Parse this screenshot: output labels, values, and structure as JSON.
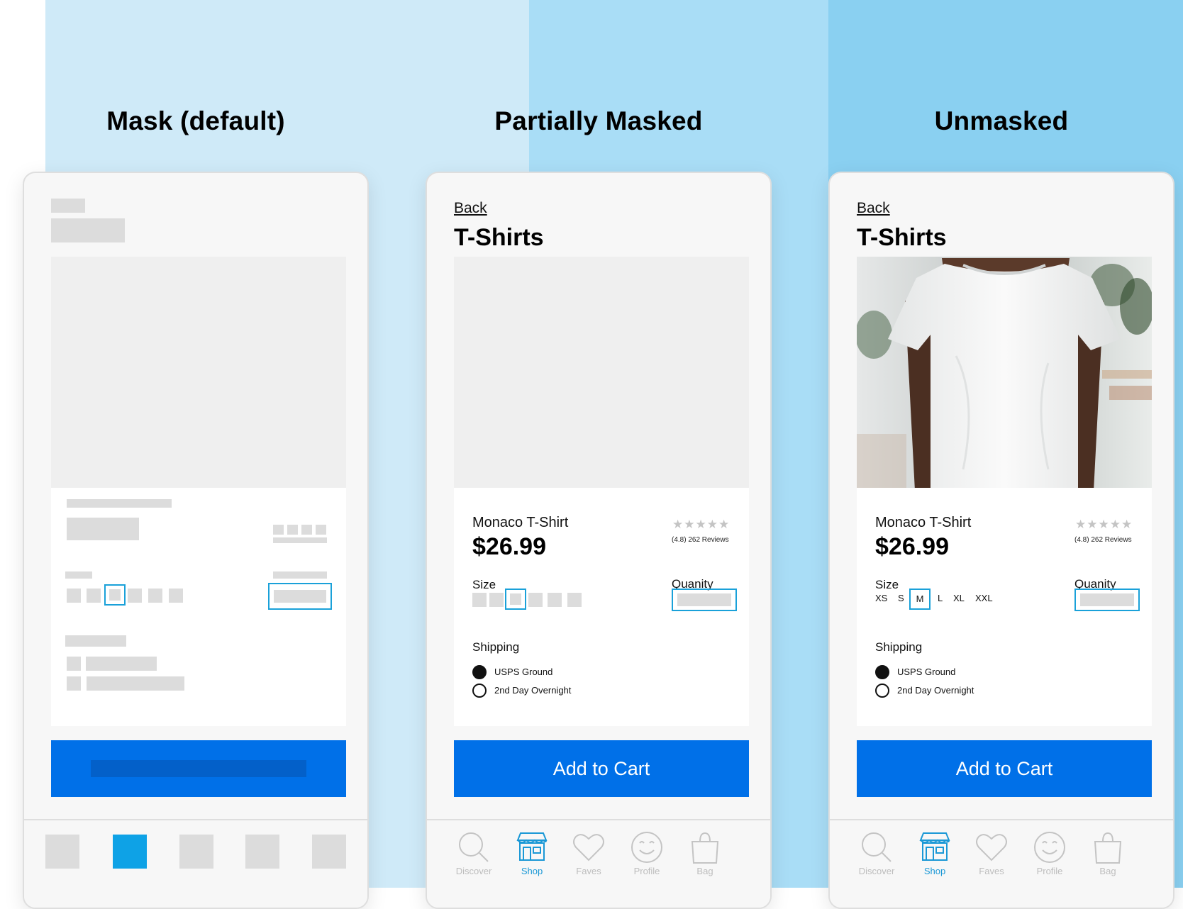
{
  "columns": [
    {
      "title": "Mask (default)"
    },
    {
      "title": "Partially Masked"
    },
    {
      "title": "Unmasked"
    }
  ],
  "screen": {
    "back_label": "Back",
    "page_title": "T-Shirts",
    "product_name": "Monaco T-Shirt",
    "price": "$26.99",
    "stars": "★★★★★",
    "rating_text": "(4.8) 262 Reviews",
    "size_label": "Size",
    "sizes": [
      "XS",
      "S",
      "M",
      "L",
      "XL",
      "XXL"
    ],
    "selected_size": "M",
    "quantity_label": "Quanity",
    "shipping_label": "Shipping",
    "shipping_options": [
      {
        "label": "USPS Ground",
        "selected": true
      },
      {
        "label": "2nd Day Overnight",
        "selected": false
      }
    ],
    "cta_label": "Add to Cart"
  },
  "tabbar": {
    "items": [
      {
        "label": "Discover",
        "icon": "magnifier-icon"
      },
      {
        "label": "Shop",
        "icon": "storefront-icon",
        "active": true
      },
      {
        "label": "Faves",
        "icon": "heart-icon"
      },
      {
        "label": "Profile",
        "icon": "smiley-icon"
      },
      {
        "label": "Bag",
        "icon": "shopping-bag-icon"
      }
    ]
  },
  "colors": {
    "accent": "#0070e8",
    "highlight": "#1aa1d9",
    "mask": "#dcdcdc",
    "band_1": "#cfeaf8",
    "band_2": "#a9ddf6",
    "band_3": "#8ad0f1"
  }
}
